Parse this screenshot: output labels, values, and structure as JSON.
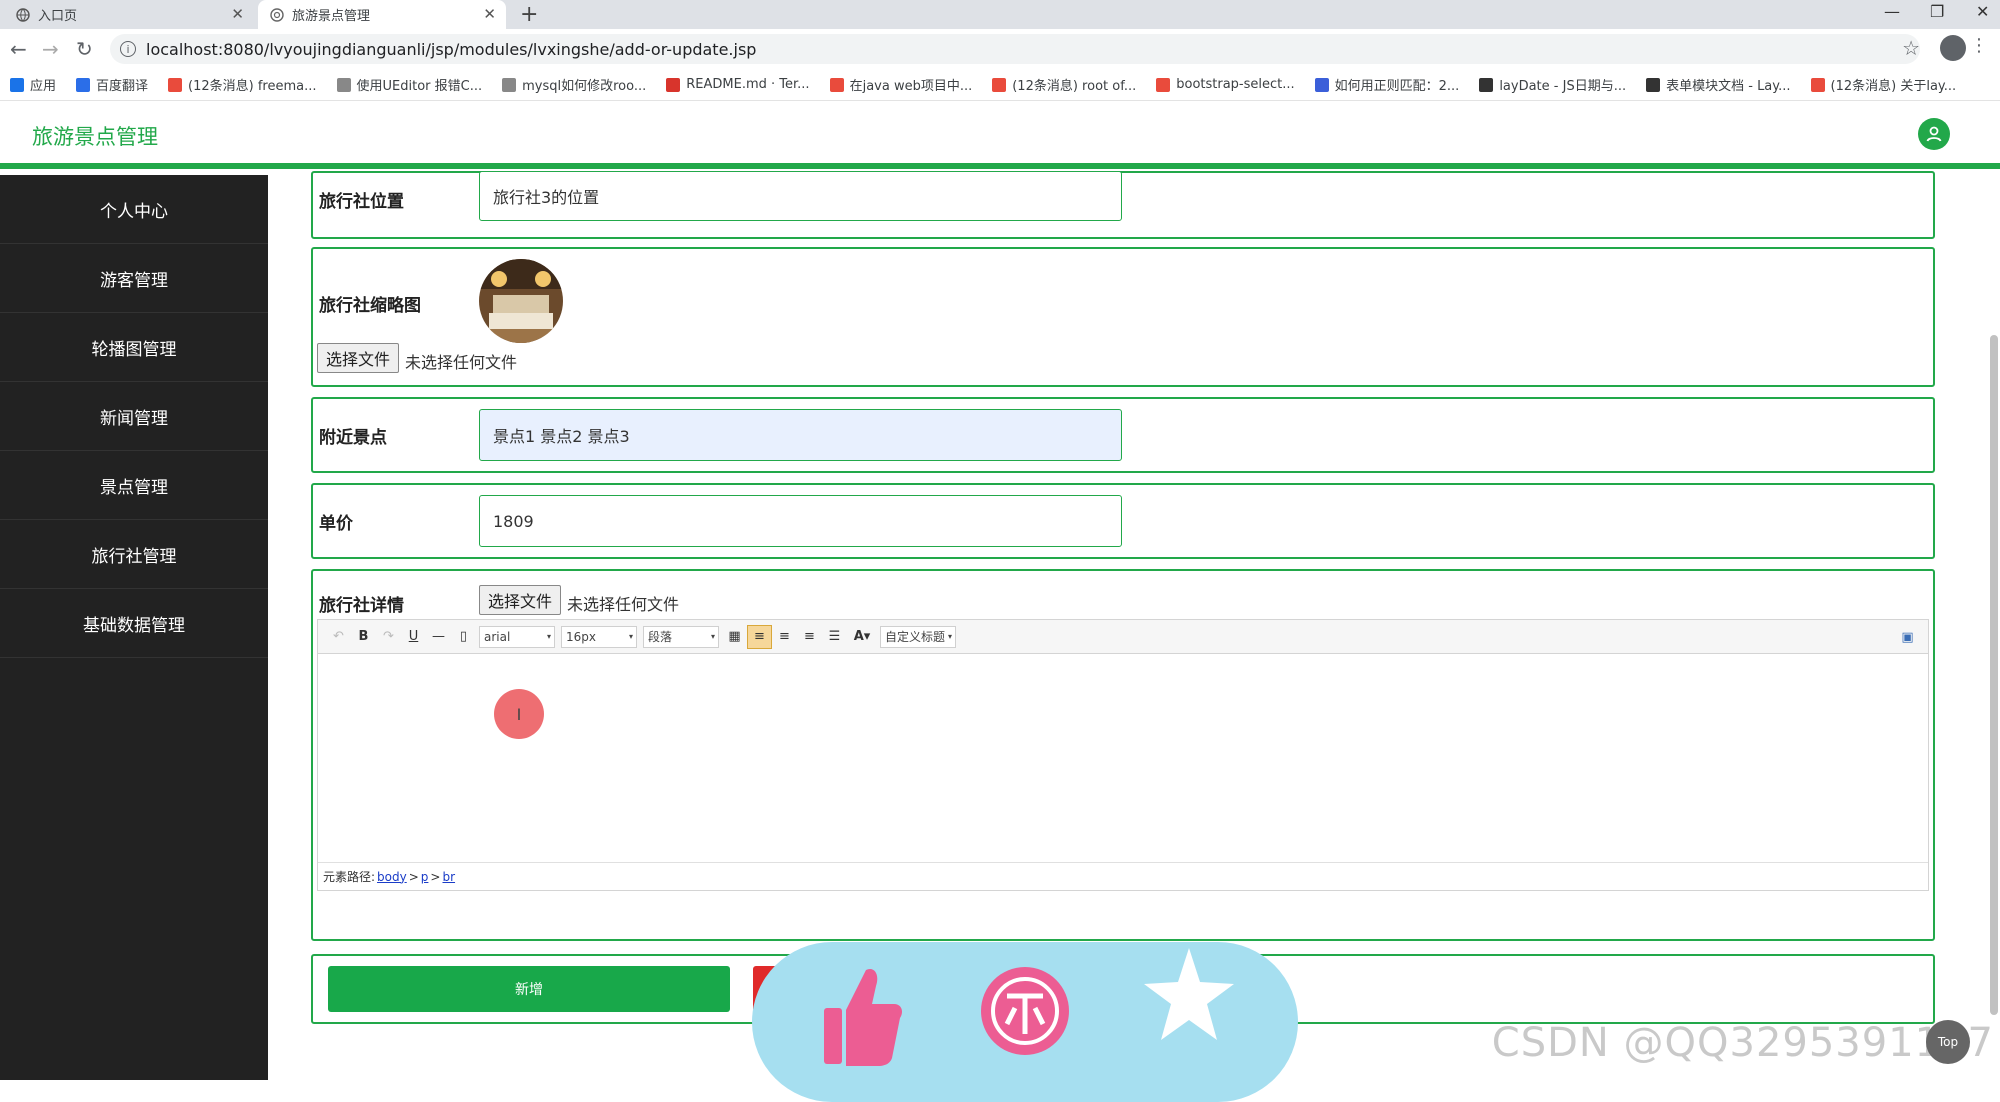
{
  "browser": {
    "tabs": [
      {
        "title": "入口页",
        "active": false
      },
      {
        "title": "旅游景点管理",
        "active": true
      }
    ],
    "url": "localhost:8080/lvyoujingdianguanli/jsp/modules/lvxingshe/add-or-update.jsp",
    "bookmarks": [
      {
        "label": "应用",
        "color": "#1a73e8"
      },
      {
        "label": "百度翻译",
        "color": "#2b6ee8"
      },
      {
        "label": "(12条消息) freema...",
        "color": "#e94b3c"
      },
      {
        "label": "使用UEditor 报错C...",
        "color": "#888888"
      },
      {
        "label": "mysql如何修改roo...",
        "color": "#888888"
      },
      {
        "label": "README.md · Ter...",
        "color": "#d8342c"
      },
      {
        "label": "在java web项目中...",
        "color": "#e94b3c"
      },
      {
        "label": "(12条消息) root of...",
        "color": "#e94b3c"
      },
      {
        "label": "bootstrap-select...",
        "color": "#e94b3c"
      },
      {
        "label": "如何用正则匹配：2...",
        "color": "#3b5fd9"
      },
      {
        "label": "layDate - JS日期与...",
        "color": "#333333"
      },
      {
        "label": "表单模块文档 - Lay...",
        "color": "#333333"
      },
      {
        "label": "(12条消息) 关于lay...",
        "color": "#e94b3c"
      }
    ]
  },
  "app": {
    "title": "旅游景点管理",
    "accent": "#22a84a"
  },
  "sidebar": {
    "items": [
      {
        "label": "个人中心"
      },
      {
        "label": "游客管理"
      },
      {
        "label": "轮播图管理"
      },
      {
        "label": "新闻管理"
      },
      {
        "label": "景点管理"
      },
      {
        "label": "旅行社管理"
      },
      {
        "label": "基础数据管理"
      }
    ]
  },
  "form": {
    "location": {
      "label": "旅行社位置",
      "value": "旅行社3的位置"
    },
    "thumbnail": {
      "label": "旅行社缩略图",
      "file_button": "选择文件",
      "file_status": "未选择任何文件"
    },
    "nearby": {
      "label": "附近景点",
      "value": "景点1 景点2 景点3"
    },
    "price": {
      "label": "单价",
      "value": "1809"
    },
    "detail": {
      "label": "旅行社详情",
      "file_button": "选择文件",
      "file_status": "未选择任何文件",
      "editor": {
        "font_family": "arial",
        "font_size": "16px",
        "paragraph": "段落",
        "custom_title": "自定义标题",
        "path_label": "元素路径:",
        "path": [
          "body",
          "p",
          "br"
        ],
        "path_sep": ">",
        "cursor": "I"
      }
    },
    "submit_label": "新增"
  },
  "overlay": {
    "watermark": "CSDN @QQ3295391197",
    "top_button": "Top"
  }
}
